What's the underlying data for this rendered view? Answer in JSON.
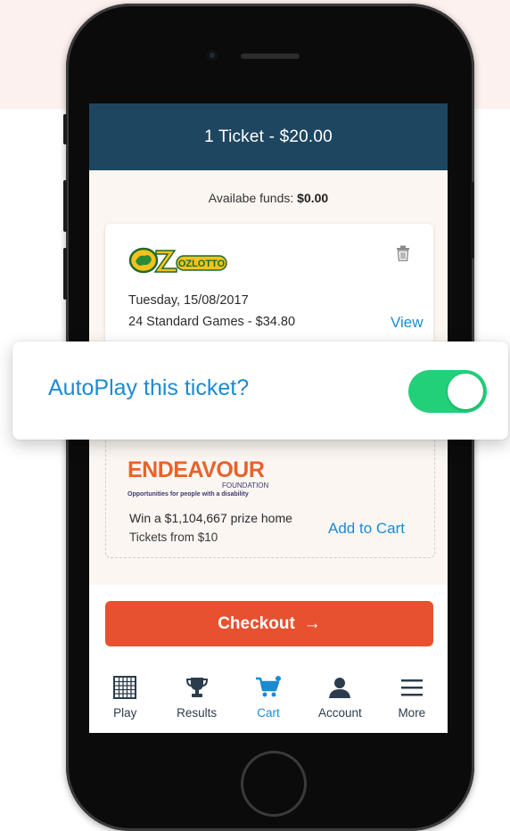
{
  "header": {
    "title": "1 Ticket - $20.00"
  },
  "funds": {
    "label": "Availabe funds:",
    "amount": "$0.00"
  },
  "ticket_card": {
    "logo_text": "OZLOTTO",
    "date": "Tuesday, 15/08/2017",
    "games": "24 Standard Games - $34.80",
    "view_label": "View"
  },
  "autoplay_popup": {
    "question": "AutoPlay this ticket?",
    "toggle_on": true
  },
  "charity_card": {
    "brand": "ENDEAVOUR",
    "brand_sub": "FOUNDATION",
    "tagline": "Opportunities for people with a disability",
    "prize_text": "Win a $1,104,667 prize home",
    "tickets_text": "Tickets from $10",
    "add_label": "Add to Cart"
  },
  "checkout": {
    "label": "Checkout",
    "arrow": "→"
  },
  "nav": {
    "items": [
      {
        "label": "Play",
        "icon": "grid-icon",
        "active": false
      },
      {
        "label": "Results",
        "icon": "trophy-icon",
        "active": false
      },
      {
        "label": "Cart",
        "icon": "cart-icon",
        "active": true
      },
      {
        "label": "Account",
        "icon": "person-icon",
        "active": false
      },
      {
        "label": "More",
        "icon": "menu-icon",
        "active": false
      }
    ]
  },
  "colors": {
    "header_bg": "#1e4660",
    "accent_blue": "#1a8bd1",
    "checkout_orange": "#e8512f",
    "toggle_green": "#22d07a",
    "brand_orange": "#e8622a"
  }
}
